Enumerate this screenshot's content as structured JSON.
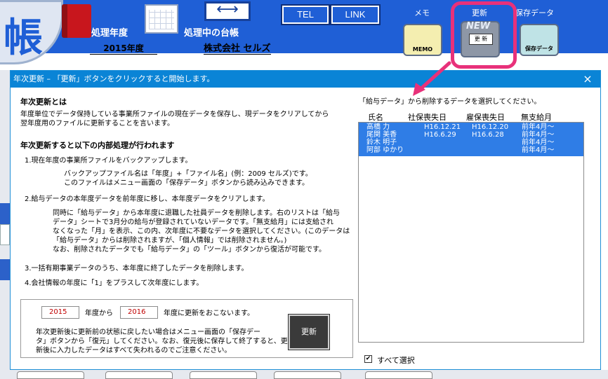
{
  "app": {
    "logo_text": "帳",
    "fiscal_year_label": "処理年度",
    "fiscal_year_value": "2015年度",
    "ledger_label": "処理中の台帳",
    "company_name": "株式会社 セルズ",
    "tel_label": "TEL",
    "link_label": "LINK",
    "memo_label": "メモ",
    "update_label": "更新",
    "backup_label": "保存データ",
    "memo_icon_caption": "MEMO",
    "update_icon_new": "NEW",
    "update_icon_caption": "更 新",
    "backup_icon_caption": "保存データ"
  },
  "dialog": {
    "title": "年次更新 – 「更新」ボタンをクリックすると開始します。",
    "close_label": "×",
    "section1_heading": "年次更新とは",
    "section1_lines": [
      "年度単位でデータ保持している事業所ファイルの現在データを保存し、現データをクリアしてから",
      "翌年度用のファイルに更新することを言います。"
    ],
    "section2_heading": "年次更新すると以下の内部処理が行われます",
    "item1": "1.現在年度の事業所ファイルをバックアップします。",
    "item1_sub": [
      "バックアップファイル名は「年度」+「ファイル名」(例：2009 セルズ)です。",
      "このファイルはメニュー画面の「保存データ」ボタンから読み込みできます。"
    ],
    "item2": "2.給与データの本年度データを前年度に移し、本年度データをクリアします。",
    "item2_sub": [
      "同時に「給与データ」から本年度に退職した社員データを削除します。右のリストは「給与",
      "データ」シートで3月分の給与が登録されていないデータです。「無支給月」には支給され",
      "なくなった「月」を表示、この内、次年度に不要なデータを選択してください。(このデータは",
      "「給与データ」からは削除されますが、「個人情報」では削除されません。)",
      "なお、削除されたデータでも「給与データ」の「ツール」ボタンから復活が可能です。"
    ],
    "item3": "3.一括有期事業データのうち、本年度に終了したデータを削除します。",
    "item4": "4.会社情報の年度に「1」をプラスして次年度にします。",
    "from_year": "2015",
    "from_label": "年度から",
    "to_year": "2016",
    "to_label": "年度に更新をおこないます。",
    "update_button": "更新",
    "note_lines": [
      "年次更新後に更新前の状態に戻したい場合はメニュー画面の「保存デー",
      "タ」ボタンから「復元」してください。なお、復元後に保存して終了すると、更",
      "新後に入力したデータはすべて失われるのでご注意ください。"
    ],
    "list_prompt": "「給与データ」から削除するデータを選択してください。",
    "list_headers": [
      "氏名",
      "社保喪失日",
      "雇保喪失日",
      "無支給月"
    ],
    "rows": [
      {
        "name": "高橋 力",
        "shaho": "H16.12.21",
        "koho": "H16.12.20",
        "month": "前年4月～"
      },
      {
        "name": "尾関 美香",
        "shaho": "H16.6.29",
        "koho": "H16.6.28",
        "month": "前年4月～"
      },
      {
        "name": "鈴木 明子",
        "shaho": "",
        "koho": "",
        "month": "前年4月～"
      },
      {
        "name": "阿部 ゆかり",
        "shaho": "",
        "koho": "",
        "month": "前年4月～"
      }
    ],
    "select_all_label": "すべて選択",
    "select_all_checked": "✔"
  },
  "colors": {
    "app_blue": "#1f5fd6",
    "titlebar": "#0a84d6",
    "selection": "#2f7de6",
    "highlight": "#e8317a",
    "year_red": "#c00000"
  }
}
